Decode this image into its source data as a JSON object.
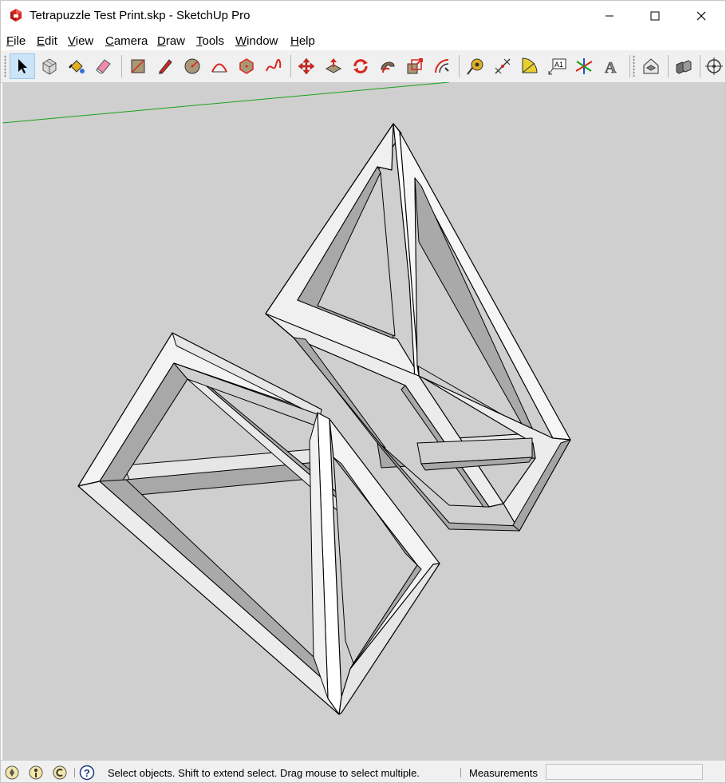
{
  "window": {
    "title": "Tetrapuzzle Test Print.skp - SketchUp Pro",
    "app_icon": "sketchup-logo-icon",
    "controls": [
      "minimize-icon",
      "maximize-icon",
      "close-icon"
    ]
  },
  "menu": {
    "items": [
      {
        "label": "File"
      },
      {
        "label": "Edit"
      },
      {
        "label": "View"
      },
      {
        "label": "Camera"
      },
      {
        "label": "Draw"
      },
      {
        "label": "Tools"
      },
      {
        "label": "Window"
      },
      {
        "label": "Help"
      }
    ]
  },
  "toolbar": {
    "tools": [
      {
        "name": "select-tool",
        "icon": "arrow-pointer-icon",
        "active": true
      },
      {
        "name": "make-component-tool",
        "icon": "component-icon"
      },
      {
        "name": "paint-bucket-tool",
        "icon": "paint-bucket-icon"
      },
      {
        "name": "eraser-tool",
        "icon": "eraser-icon"
      },
      {
        "name": "rectangle-tool",
        "icon": "rectangle-icon"
      },
      {
        "name": "line-tool",
        "icon": "pencil-icon"
      },
      {
        "name": "circle-tool",
        "icon": "circle-icon"
      },
      {
        "name": "arc-tool",
        "icon": "arc-icon"
      },
      {
        "name": "polygon-tool",
        "icon": "polygon-icon"
      },
      {
        "name": "freehand-tool",
        "icon": "freehand-icon"
      },
      {
        "name": "move-tool",
        "icon": "move-arrows-icon"
      },
      {
        "name": "push-pull-tool",
        "icon": "push-pull-icon"
      },
      {
        "name": "rotate-tool",
        "icon": "rotate-icon"
      },
      {
        "name": "follow-me-tool",
        "icon": "follow-me-icon"
      },
      {
        "name": "scale-tool",
        "icon": "scale-icon"
      },
      {
        "name": "offset-tool",
        "icon": "offset-icon"
      },
      {
        "name": "tape-measure-tool",
        "icon": "tape-measure-icon"
      },
      {
        "name": "dimensions-tool",
        "icon": "dimensions-icon"
      },
      {
        "name": "protractor-tool",
        "icon": "protractor-icon"
      },
      {
        "name": "text-tool",
        "icon": "text-label-icon",
        "glyph": "A1"
      },
      {
        "name": "axes-tool",
        "icon": "axes-icon"
      },
      {
        "name": "3d-text-tool",
        "icon": "3d-text-icon",
        "glyph": "A"
      },
      {
        "name": "warehouse-tool",
        "icon": "warehouse-icon"
      },
      {
        "name": "extension-warehouse-tool",
        "icon": "extension-warehouse-icon"
      },
      {
        "name": "orbit-tool",
        "icon": "orbit-icon"
      }
    ]
  },
  "colors": {
    "viewport_bg": "#cfcfcf",
    "green_axis": "#1aa01a",
    "face_light": "#f3f3f3",
    "face_mid": "#e6e6e6",
    "face_dark": "#a8a8a8",
    "edge": "#000000",
    "accent_red": "#d9261c"
  },
  "status": {
    "icons": [
      "geo-location-icon",
      "credits-icon",
      "sign-in-icon",
      "help-icon"
    ],
    "message": "Select objects. Shift to extend select. Drag mouse to select multiple.",
    "measurements_label": "Measurements",
    "measurements_value": ""
  }
}
